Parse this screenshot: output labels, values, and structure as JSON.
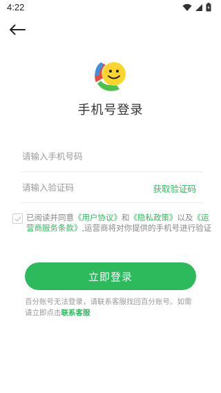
{
  "status_bar": {
    "time": "4:22"
  },
  "header": {
    "title": "手机号登录"
  },
  "form": {
    "phone_placeholder": "请输入手机号码",
    "code_placeholder": "请输入验证码",
    "get_code_label": "获取验证码"
  },
  "agreement": {
    "prefix": "已阅读并同意",
    "user_agreement": "《用户协议》",
    "and": "和",
    "privacy_policy": "《隐私政策》",
    "and2": "以及",
    "carrier_terms": "《运营商服务条款》",
    "suffix": ",运营商将对你提供的手机号进行验证"
  },
  "login_button_label": "立即登录",
  "help": {
    "text": "百分账号无法登录，请联系客服找回百分账号。如需请立即点击",
    "link": "联系客服"
  },
  "colors": {
    "accent": "#2dba5c"
  }
}
